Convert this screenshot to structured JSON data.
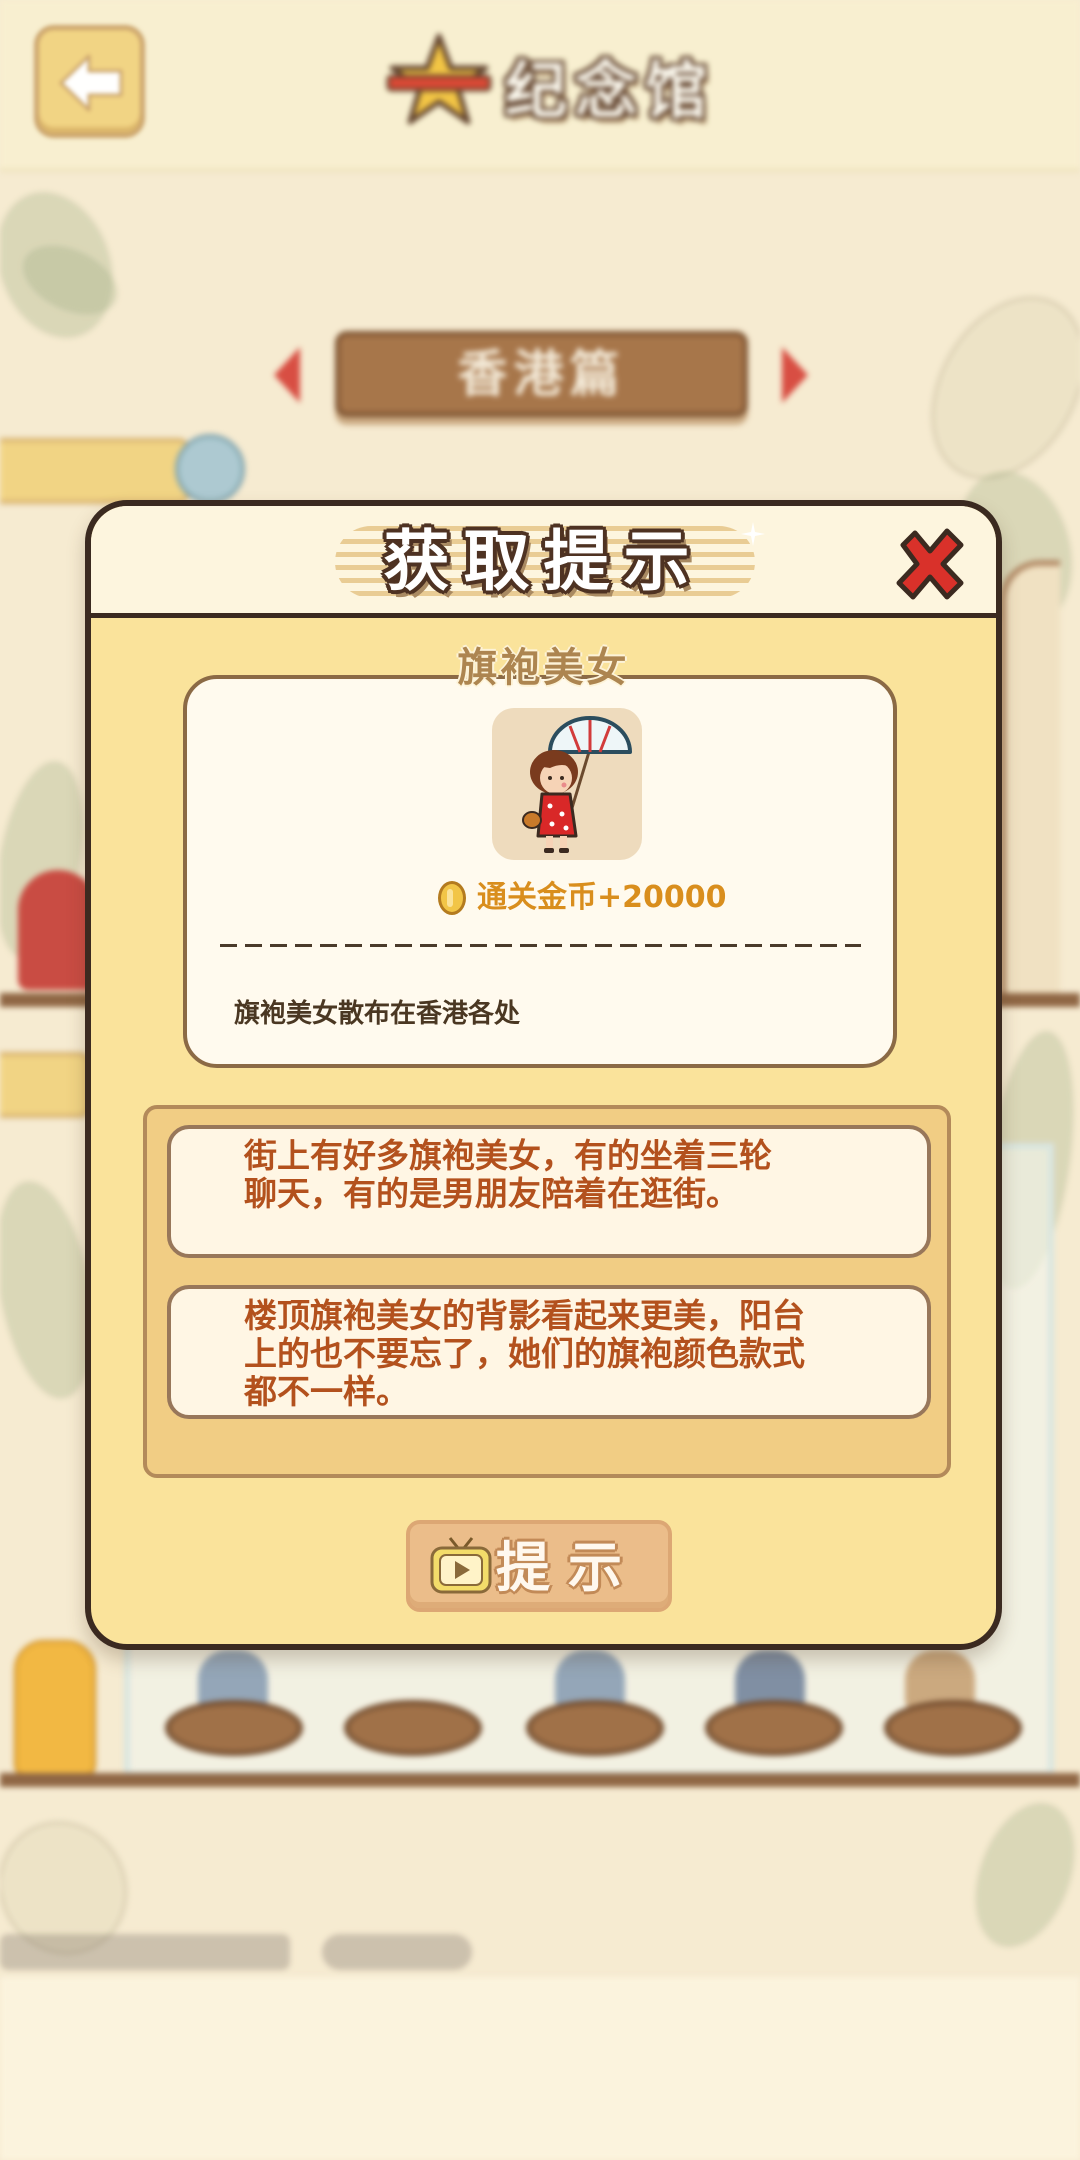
{
  "topbar": {
    "title": "纪念馆",
    "back_icon": "back-arrow-icon",
    "title_icon": "star-icon"
  },
  "category_selector": {
    "label": "香港篇",
    "prev_icon": "arrow-left-icon",
    "next_icon": "arrow-right-icon"
  },
  "modal": {
    "title": "获取提示",
    "close_icon": "close-icon",
    "item": {
      "name": "旗袍美女",
      "icon": "qipao-woman-icon",
      "reward_icon": "coin-icon",
      "reward_text": "通关金币+20000",
      "description": "旗袍美女散布在香港各处"
    },
    "hints": [
      {
        "lines": [
          "街上有好多旗袍美女，有的坐着三轮",
          "聊天，有的是男朋友陪着在逛街。"
        ]
      },
      {
        "lines": [
          "楼顶旗袍美女的背影看起来更美，阳台",
          "上的也不要忘了，她们的旗袍颜色款式",
          "都不一样。"
        ]
      }
    ],
    "hint_button": {
      "label": "提示",
      "icon": "video-tv-icon"
    }
  },
  "colors": {
    "modal_background": "#fae39b",
    "modal_border": "#3b2a20",
    "hint_text": "#b3511d",
    "reward_text": "#d98e1d",
    "close_icon": "#d9312a",
    "category_pill": "#a36f42"
  }
}
